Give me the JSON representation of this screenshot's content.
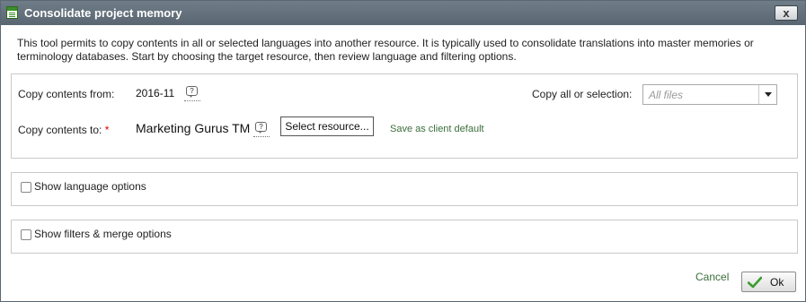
{
  "dialog": {
    "title": "Consolidate project memory",
    "close_glyph": "x"
  },
  "intro": "This tool permits to copy contents in all or selected languages into another resource. It is typically used to consolidate translations into master memories or terminology databases. Start by choosing the target resource, then review language and filtering options.",
  "copy_from": {
    "label": "Copy contents from:",
    "value": "2016-11",
    "info_icon": "comment-bubble-icon"
  },
  "copy_to": {
    "label": "Copy contents to:",
    "required_mark": "*",
    "value": "Marketing Gurus TM",
    "info_icon": "comment-bubble-icon",
    "select_button": "Select resource...",
    "save_default_link": "Save as client default"
  },
  "selection": {
    "label": "Copy all or selection:",
    "placeholder": "All files"
  },
  "options": {
    "language": {
      "label": "Show language options",
      "checked": false
    },
    "filters": {
      "label": "Show filters & merge options",
      "checked": false
    }
  },
  "footer": {
    "cancel": "Cancel",
    "ok": "Ok",
    "ok_icon": "checkmark-icon"
  },
  "colors": {
    "titlebar": "#5f6b76",
    "link": "#3b6e3b",
    "required": "#dd0000",
    "ok_check": "#3c9c2e"
  }
}
